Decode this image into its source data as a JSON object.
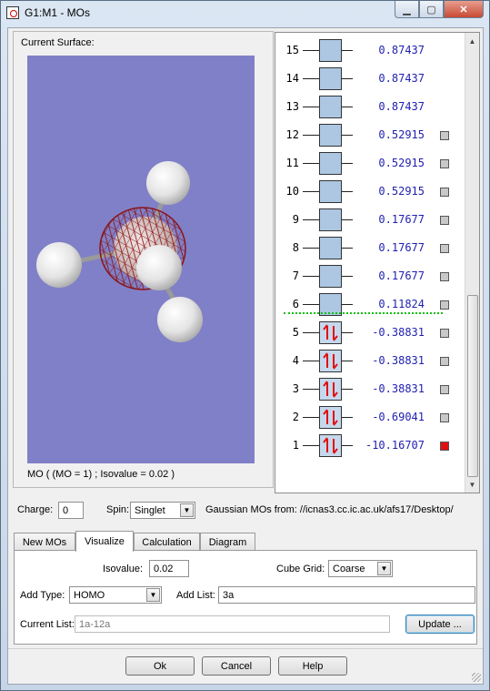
{
  "window": {
    "title": "G1:M1 - MOs",
    "minimize_glyph": "▁",
    "maximize_glyph": "▢",
    "close_glyph": "✕"
  },
  "viewer": {
    "surface_label": "Current Surface:",
    "caption": "MO ( (MO = 1) ; Isovalue = 0.02 )",
    "background_color": "#8080c8"
  },
  "orbitals": [
    {
      "n": "15",
      "energy": "0.87437",
      "occupied": false,
      "checkbox": false,
      "checked": false
    },
    {
      "n": "14",
      "energy": "0.87437",
      "occupied": false,
      "checkbox": false,
      "checked": false
    },
    {
      "n": "13",
      "energy": "0.87437",
      "occupied": false,
      "checkbox": false,
      "checked": false
    },
    {
      "n": "12",
      "energy": "0.52915",
      "occupied": false,
      "checkbox": true,
      "checked": false
    },
    {
      "n": "11",
      "energy": "0.52915",
      "occupied": false,
      "checkbox": true,
      "checked": false
    },
    {
      "n": "10",
      "energy": "0.52915",
      "occupied": false,
      "checkbox": true,
      "checked": false
    },
    {
      "n": "9",
      "energy": "0.17677",
      "occupied": false,
      "checkbox": true,
      "checked": false
    },
    {
      "n": "8",
      "energy": "0.17677",
      "occupied": false,
      "checkbox": true,
      "checked": false
    },
    {
      "n": "7",
      "energy": "0.17677",
      "occupied": false,
      "checkbox": true,
      "checked": false
    },
    {
      "n": "6",
      "energy": "0.11824",
      "occupied": false,
      "checkbox": true,
      "checked": false
    },
    {
      "n": "5",
      "energy": "-0.38831",
      "occupied": true,
      "checkbox": true,
      "checked": false
    },
    {
      "n": "4",
      "energy": "-0.38831",
      "occupied": true,
      "checkbox": true,
      "checked": false
    },
    {
      "n": "3",
      "energy": "-0.38831",
      "occupied": true,
      "checkbox": true,
      "checked": false
    },
    {
      "n": "2",
      "energy": "-0.69041",
      "occupied": true,
      "checkbox": true,
      "checked": false
    },
    {
      "n": "1",
      "energy": "-10.16707",
      "occupied": true,
      "checkbox": true,
      "checked": true
    }
  ],
  "params": {
    "charge_label": "Charge:",
    "charge_value": "0",
    "spin_label": "Spin:",
    "spin_value": "Singlet",
    "source_text": "Gaussian MOs from:  //icnas3.cc.ic.ac.uk/afs17/Desktop/"
  },
  "tabs": [
    "New MOs",
    "Visualize",
    "Calculation",
    "Diagram"
  ],
  "active_tab": "Visualize",
  "visualize": {
    "isovalue_label": "Isovalue:",
    "isovalue": "0.02",
    "cube_grid_label": "Cube Grid:",
    "cube_grid": "Coarse",
    "add_type_label": "Add Type:",
    "add_type": "HOMO",
    "add_list_label": "Add List:",
    "add_list": "3a",
    "current_list_label": "Current List:",
    "current_list": "1a-12a",
    "update_button": "Update ..."
  },
  "footer": {
    "ok": "Ok",
    "cancel": "Cancel",
    "help": "Help"
  },
  "colors": {
    "occupied_arrow": "#e01010",
    "energy_text": "#1f1fb0",
    "homo_lumo_divider": "#10c010",
    "orbital_box": "#adc7e3",
    "mesh": "#8b1010"
  }
}
